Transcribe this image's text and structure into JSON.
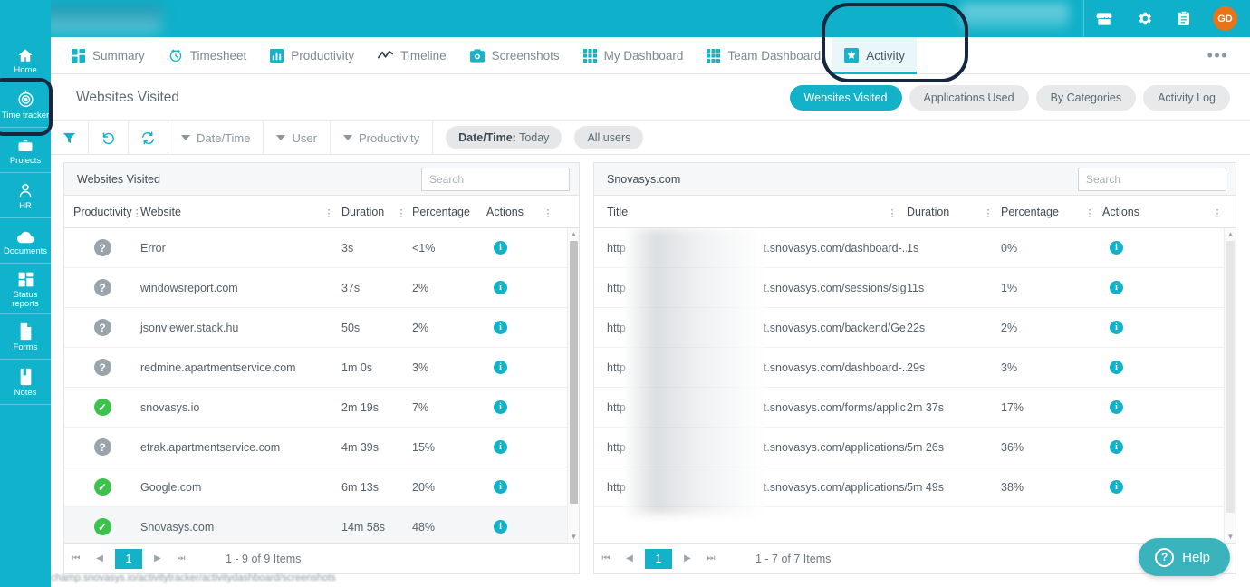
{
  "header": {
    "icons": [
      {
        "name": "store-icon",
        "glyph": "store"
      },
      {
        "name": "gear-icon",
        "glyph": "gear"
      },
      {
        "name": "clipboard-icon",
        "glyph": "clipboard"
      }
    ],
    "avatar_initials": "GD"
  },
  "sidebar": {
    "items": [
      {
        "label": "Home",
        "icon": "home-icon"
      },
      {
        "label": "Time tracker",
        "icon": "time-tracker-icon"
      },
      {
        "label": "Projects",
        "icon": "briefcase-icon"
      },
      {
        "label": "HR",
        "icon": "person-icon"
      },
      {
        "label": "Documents",
        "icon": "cloud-icon"
      },
      {
        "label": "Status reports",
        "icon": "grid-icon"
      },
      {
        "label": "Forms",
        "icon": "file-icon"
      },
      {
        "label": "Notes",
        "icon": "note-icon"
      }
    ]
  },
  "tabs": [
    {
      "label": "Summary",
      "icon": "grid-squares-icon",
      "active": false
    },
    {
      "label": "Timesheet",
      "icon": "clock-icon",
      "active": false
    },
    {
      "label": "Productivity",
      "icon": "bar-chart-icon",
      "active": false
    },
    {
      "label": "Timeline",
      "icon": "trend-line-icon",
      "active": false
    },
    {
      "label": "Screenshots",
      "icon": "camera-icon",
      "active": false
    },
    {
      "label": "My Dashboard",
      "icon": "dashboard-grid-icon",
      "active": false
    },
    {
      "label": "Team Dashboard",
      "icon": "dashboard-grid-icon",
      "active": false
    },
    {
      "label": "Activity",
      "icon": "activity-star-icon",
      "active": true
    }
  ],
  "page": {
    "title": "Websites Visited",
    "segments": [
      {
        "label": "Websites Visited",
        "active": true
      },
      {
        "label": "Applications Used",
        "active": false
      },
      {
        "label": "By Categories",
        "active": false
      },
      {
        "label": "Activity Log",
        "active": false
      }
    ]
  },
  "filterbar": {
    "icons": [
      {
        "name": "filter-icon"
      },
      {
        "name": "undo-icon"
      },
      {
        "name": "refresh-icon"
      }
    ],
    "dropdowns": [
      "Date/Time",
      "User",
      "Productivity"
    ],
    "chips": [
      {
        "label_bold": "Date/Time:",
        "label": " Today"
      },
      {
        "label_bold": "",
        "label": "All users"
      }
    ]
  },
  "left_panel": {
    "title": "Websites Visited",
    "search_placeholder": "Search",
    "columns": [
      "Productivity",
      "Website",
      "Duration",
      "Percentage",
      "Actions"
    ],
    "rows": [
      {
        "productivity": "productive",
        "website": "Snovasys.com",
        "duration": "14m 58s",
        "percentage": "48%",
        "action": "info-icon",
        "selected": true
      },
      {
        "productivity": "productive",
        "website": "Google.com",
        "duration": "6m 13s",
        "percentage": "20%",
        "action": "info-icon",
        "selected": false
      },
      {
        "productivity": "unknown",
        "website": "etrak.apartmentservice.com",
        "duration": "4m 39s",
        "percentage": "15%",
        "action": "info-icon",
        "selected": false
      },
      {
        "productivity": "productive",
        "website": "snovasys.io",
        "duration": "2m 19s",
        "percentage": "7%",
        "action": "info-icon",
        "selected": false
      },
      {
        "productivity": "unknown",
        "website": "redmine.apartmentservice.com",
        "duration": "1m 0s",
        "percentage": "3%",
        "action": "info-icon",
        "selected": false
      },
      {
        "productivity": "unknown",
        "website": "jsonviewer.stack.hu",
        "duration": "50s",
        "percentage": "2%",
        "action": "info-icon",
        "selected": false
      },
      {
        "productivity": "unknown",
        "website": "windowsreport.com",
        "duration": "37s",
        "percentage": "2%",
        "action": "info-icon",
        "selected": false
      },
      {
        "productivity": "unknown",
        "website": "Error",
        "duration": "3s",
        "percentage": "<1%",
        "action": "info-icon",
        "selected": false
      }
    ],
    "pager_info": "1 - 9 of 9 Items",
    "page_number": "1"
  },
  "right_panel": {
    "title": "Snovasys.com",
    "search_placeholder": "Search",
    "columns": [
      "Title",
      "Duration",
      "Percentage",
      "Actions"
    ],
    "rows": [
      {
        "title_prefix": "http",
        "title_suffix": "t.snovasys.com/applications/...",
        "duration": "5m 49s",
        "percentage": "38%",
        "action": "info-icon"
      },
      {
        "title_prefix": "http",
        "title_suffix": "t.snovasys.com/applications/...",
        "duration": "5m 26s",
        "percentage": "36%",
        "action": "info-icon"
      },
      {
        "title_prefix": "http",
        "title_suffix": "t.snovasys.com/forms/applic...",
        "duration": "2m 37s",
        "percentage": "17%",
        "action": "info-icon"
      },
      {
        "title_prefix": "http",
        "title_suffix": "t.snovasys.com/dashboard-...",
        "duration": "29s",
        "percentage": "3%",
        "action": "info-icon"
      },
      {
        "title_prefix": "http",
        "title_suffix": "t.snovasys.com/backend/Ge...",
        "duration": "22s",
        "percentage": "2%",
        "action": "info-icon"
      },
      {
        "title_prefix": "http",
        "title_suffix": "t.snovasys.com/sessions/sig...",
        "duration": "11s",
        "percentage": "1%",
        "action": "info-icon"
      },
      {
        "title_prefix": "http",
        "title_suffix": "t.snovasys.com/dashboard-...",
        "duration": "1s",
        "percentage": "0%",
        "action": "info-icon"
      }
    ],
    "pager_info": "1 - 7 of 7 Items",
    "page_number": "1"
  },
  "help": {
    "label": "Help"
  },
  "status_url": "https://timechamp.snovasys.io/activitytracker/activitydashboard/screenshots",
  "colors": {
    "brand_teal": "#10b3cb",
    "accent": "#12b2c9",
    "green": "#3cc14b",
    "grey_badge": "#9aa4ab",
    "avatar_orange": "#e8741a",
    "highlight_ring": "#16273f"
  }
}
